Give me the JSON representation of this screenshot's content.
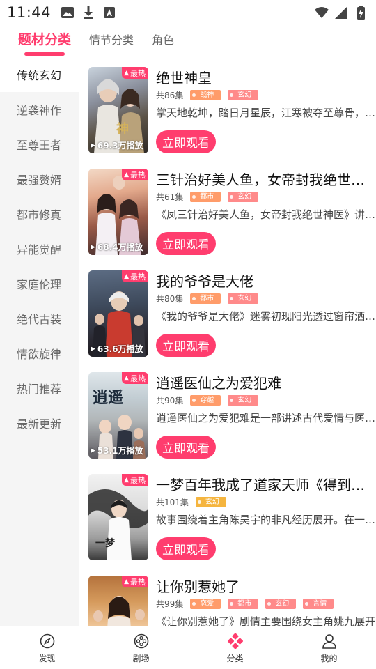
{
  "status_bar": {
    "time": "11:44"
  },
  "top_tabs": [
    {
      "label": "题材分类",
      "active": true
    },
    {
      "label": "情节分类",
      "active": false
    },
    {
      "label": "角色",
      "active": false
    }
  ],
  "sidebar": {
    "items": [
      {
        "label": "传统玄幻",
        "active": true
      },
      {
        "label": "逆袭神作",
        "active": false
      },
      {
        "label": "至尊王者",
        "active": false
      },
      {
        "label": "最强赘婿",
        "active": false
      },
      {
        "label": "都市修真",
        "active": false
      },
      {
        "label": "异能觉醒",
        "active": false
      },
      {
        "label": "家庭伦理",
        "active": false
      },
      {
        "label": "绝代古装",
        "active": false
      },
      {
        "label": "情欲旋律",
        "active": false
      },
      {
        "label": "热门推荐",
        "active": false
      },
      {
        "label": "最新更新",
        "active": false
      }
    ]
  },
  "cards": [
    {
      "title": "绝世神皇",
      "episodes": "共86集",
      "tags": [
        {
          "label": "战神",
          "color": "orange"
        },
        {
          "label": "玄幻",
          "color": "pink"
        }
      ],
      "desc": "掌天地乾坤，踏日月星辰，江寒被夺至尊骨，惨遭灭门",
      "hot": "最热",
      "plays": "69.3万播放",
      "button": "立即观看"
    },
    {
      "title": "三针治好美人鱼，女帝封我绝世神医",
      "episodes": "共61集",
      "tags": [
        {
          "label": "都市",
          "color": "orange"
        },
        {
          "label": "玄幻",
          "color": "pink"
        }
      ],
      "desc": "《凤三针治好美人鱼，女帝封我绝世神医》讲述了",
      "hot": "最热",
      "plays": "68.4万播放",
      "button": "立即观看"
    },
    {
      "title": "我的爷爷是大佬",
      "episodes": "共80集",
      "tags": [
        {
          "label": "都市",
          "color": "orange"
        },
        {
          "label": "玄幻",
          "color": "pink"
        }
      ],
      "desc": "《我的爷爷是大佬》迷雾初现阳光透过窗帘洒进房间",
      "hot": "最热",
      "plays": "63.6万播放",
      "button": "立即观看"
    },
    {
      "title": "逍遥医仙之为爱犯难",
      "episodes": "共90集",
      "tags": [
        {
          "label": "穿越",
          "color": "orange"
        },
        {
          "label": "玄幻",
          "color": "pink"
        }
      ],
      "desc": "逍遥医仙之为爱犯难是一部讲述古代爱情与医术的短剧",
      "hot": "最热",
      "plays": "53.1万播放",
      "button": "立即观看"
    },
    {
      "title": "一梦百年我成了道家天师《得到道家天师》",
      "episodes": "共101集",
      "tags": [
        {
          "label": "玄幻",
          "color": "gold"
        }
      ],
      "desc": "故事围绕着主角陈昊宇的非凡经历展开。在一次意外中",
      "hot": "最热",
      "plays": "",
      "button": "立即观看"
    },
    {
      "title": "让你别惹她了",
      "episodes": "共99集",
      "tags": [
        {
          "label": "恋爱",
          "color": "orange"
        },
        {
          "label": "都市",
          "color": "pink"
        },
        {
          "label": "玄幻",
          "color": "pink"
        },
        {
          "label": "言情",
          "color": "pink"
        }
      ],
      "desc": "《让你别惹她了》剧情主要围绕女主角姚九展开",
      "hot": "最热",
      "plays": "",
      "button": "立即观看"
    }
  ],
  "bottom_nav": [
    {
      "label": "发现",
      "icon": "compass-icon",
      "active": false
    },
    {
      "label": "剧场",
      "icon": "film-reel-icon",
      "active": false
    },
    {
      "label": "分类",
      "icon": "category-icon",
      "active": true
    },
    {
      "label": "我的",
      "icon": "profile-icon",
      "active": false
    }
  ],
  "colors": {
    "accent": "#ff3d6e",
    "tag_orange": "#ff9c6a",
    "tag_pink": "#ff8a8a",
    "tag_gold": "#f5b53f"
  }
}
